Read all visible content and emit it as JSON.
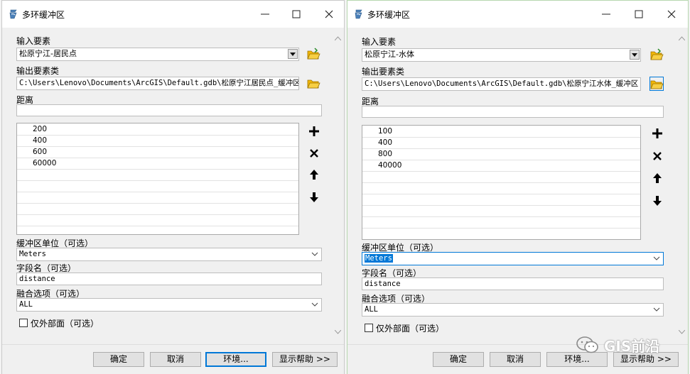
{
  "colors": {
    "accent": "#0078d7",
    "folder": "#f2b705"
  },
  "left": {
    "title": "多环缓冲区",
    "input_label": "输入要素",
    "input_value": "松原宁江-居民点",
    "output_label": "输出要素类",
    "output_value": "C:\\Users\\Lenovo\\Documents\\ArcGIS\\Default.gdb\\松原宁江居民点_缓冲区",
    "distance_label": "距离",
    "distance_value": "",
    "distances": [
      "200",
      "400",
      "600",
      "60000"
    ],
    "unit_label": "缓冲区单位（可选）",
    "unit_value": "Meters",
    "field_label": "字段名（可选）",
    "field_value": "distance",
    "dissolve_label": "融合选项（可选）",
    "dissolve_value": "ALL",
    "outside_label": "仅外部面（可选）",
    "ok": "确定",
    "cancel": "取消",
    "env": "环境...",
    "help": "显示帮助 >>"
  },
  "right": {
    "title": "多环缓冲区",
    "input_label": "输入要素",
    "input_value": "松原宁江-水体",
    "output_label": "输出要素类",
    "output_value": "C:\\Users\\Lenovo\\Documents\\ArcGIS\\Default.gdb\\松原宁江水体_缓冲区",
    "distance_label": "距离",
    "distance_value": "",
    "distances": [
      "100",
      "400",
      "800",
      "40000"
    ],
    "unit_label": "缓冲区单位（可选）",
    "unit_value": "Meters",
    "field_label": "字段名（可选）",
    "field_value": "distance",
    "dissolve_label": "融合选项（可选）",
    "dissolve_value": "ALL",
    "outside_label": "仅外部面（可选）",
    "ok": "确定",
    "cancel": "取消",
    "env": "环境...",
    "help": "显示帮助 >>"
  },
  "watermark": {
    "text": "GIS前沿",
    "icon": "wechat-icon"
  }
}
